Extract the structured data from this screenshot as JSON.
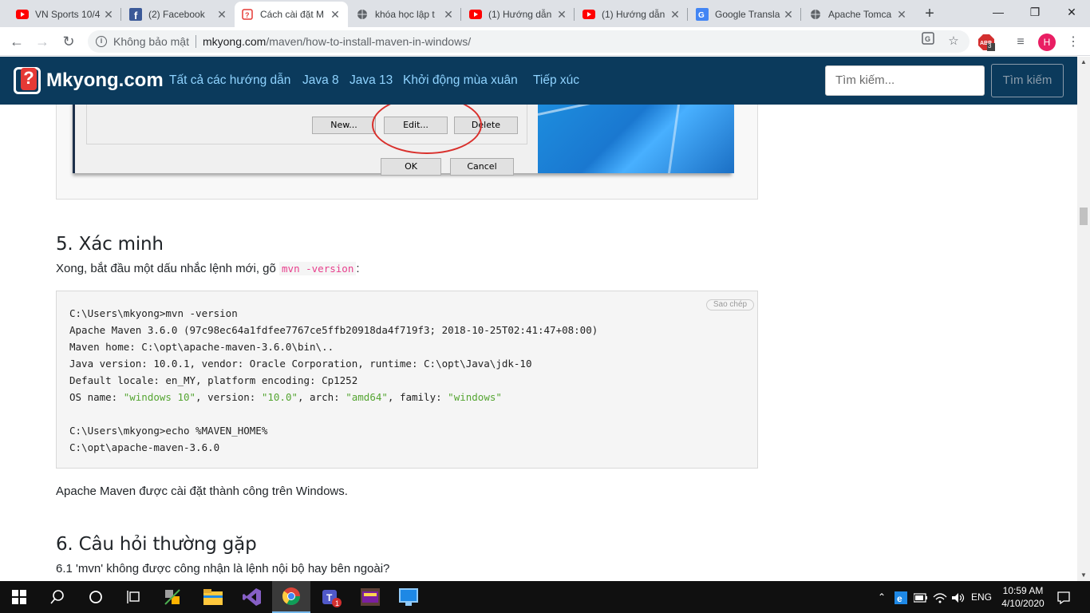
{
  "browser": {
    "tabs": [
      {
        "title": "VN Sports 10/4",
        "icon": "youtube-icon"
      },
      {
        "title": "(2) Facebook",
        "icon": "facebook-icon"
      },
      {
        "title": "Cách cài đặt M",
        "icon": "mkyong-icon"
      },
      {
        "title": "khóa học lập t",
        "icon": "globe-icon"
      },
      {
        "title": "(1) Hướng dẫn",
        "icon": "youtube-icon"
      },
      {
        "title": "(1) Hướng dẫn",
        "icon": "youtube-icon"
      },
      {
        "title": "Google Transla",
        "icon": "google-translate-icon"
      },
      {
        "title": "Apache Tomca",
        "icon": "globe-icon"
      }
    ],
    "address": {
      "security": "Không bảo mật",
      "host": "mkyong.com",
      "path": "/maven/how-to-install-maven-in-windows/"
    },
    "extension_badge": "3",
    "profile_initial": "H"
  },
  "site": {
    "logo": "Mkyong.com",
    "nav": [
      "Tất cả các hướng dẫn",
      "Java 8",
      "Java 13",
      "Khởi động mùa xuân",
      "Tiếp xúc"
    ],
    "search_placeholder": "Tìm kiếm...",
    "search_button": "Tìm kiếm"
  },
  "screenshot_dialog": {
    "buttons": [
      "New...",
      "Edit...",
      "Delete",
      "OK",
      "Cancel"
    ]
  },
  "article": {
    "section5_title": "5. Xác minh",
    "section5_intro": "Xong, bắt đầu một dấu nhắc lệnh mới, gõ",
    "section5_cmd": "mvn -version",
    "section5_colon": ":",
    "copy_label": "Sao chép",
    "code_lines": [
      "C:\\Users\\mkyong>mvn -version",
      "Apache Maven 3.6.0 (97c98ec64a1fdfee7767ce5ffb20918da4f719f3; 2018-10-25T02:41:47+08:00)",
      "Maven home: C:\\opt\\apache-maven-3.6.0\\bin\\..",
      "Java version: 10.0.1, vendor: Oracle Corporation, runtime: C:\\opt\\Java\\jdk-10",
      "Default locale: en_MY, platform encoding: Cp1252",
      "OS name: \"windows 10\", version: \"10.0\", arch: \"amd64\", family: \"windows\"",
      "",
      "C:\\Users\\mkyong>echo %MAVEN_HOME%",
      "C:\\opt\\apache-maven-3.6.0"
    ],
    "success_text": "Apache Maven được cài đặt thành công trên Windows.",
    "section6_title": "6. Câu hỏi thường gặp",
    "faq1": "6.1 'mvn' không được công nhận là lệnh nội bộ hay bên ngoài?"
  },
  "taskbar": {
    "lang": "ENG",
    "time": "10:59 AM",
    "date": "4/10/2020"
  },
  "colors": {
    "nav_bg": "#0b3a5c",
    "nav_link": "#8fd3ff",
    "code_string": "#55a532",
    "inline_code": "#e83e8c"
  }
}
